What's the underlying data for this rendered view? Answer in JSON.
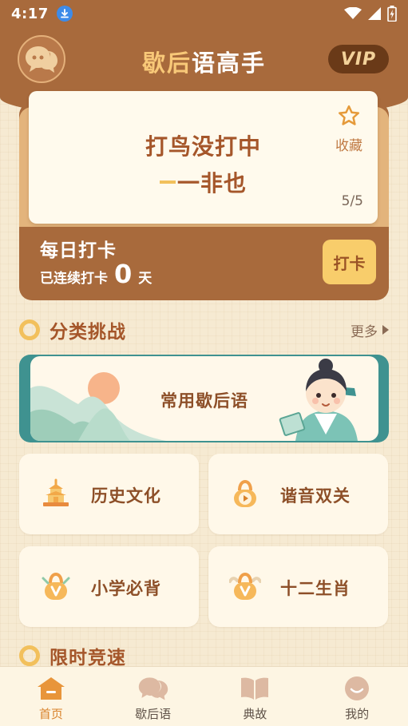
{
  "status_bar": {
    "time": "4:17"
  },
  "header": {
    "title_part1": "歇后",
    "title_part2": "语高手",
    "vip_label": "VIP"
  },
  "riddle": {
    "question": "打鸟没打中",
    "answer": "一非也",
    "favorite_label": "收藏",
    "counter": "5/5"
  },
  "checkin": {
    "title": "每日打卡",
    "streak_label": "已连续打卡",
    "streak_days": "0",
    "streak_unit": "天",
    "button_label": "打卡"
  },
  "category_section": {
    "title": "分类挑战",
    "more_label": "更多"
  },
  "banner": {
    "title": "常用歇后语"
  },
  "categories": [
    {
      "label": "历史文化",
      "icon": "pagoda-icon"
    },
    {
      "label": "谐音双关",
      "icon": "lock-play-icon"
    },
    {
      "label": "小学必背",
      "icon": "lock-v-icon"
    },
    {
      "label": "十二生肖",
      "icon": "zodiac-lock-icon"
    }
  ],
  "timed_section": {
    "title": "限时竞速"
  },
  "tabbar": {
    "active": "首页",
    "items": [
      {
        "label": "首页",
        "icon": "home-icon"
      },
      {
        "label": "歇后语",
        "icon": "chat-bubbles-icon"
      },
      {
        "label": "典故",
        "icon": "book-icon"
      },
      {
        "label": "我的",
        "icon": "smile-icon"
      }
    ]
  },
  "colors": {
    "header_brown": "#a86a3c",
    "accent_gold": "#f2c05c",
    "title_text": "#a5562a",
    "teal": "#3f9290",
    "tab_active": "#d9822b"
  }
}
